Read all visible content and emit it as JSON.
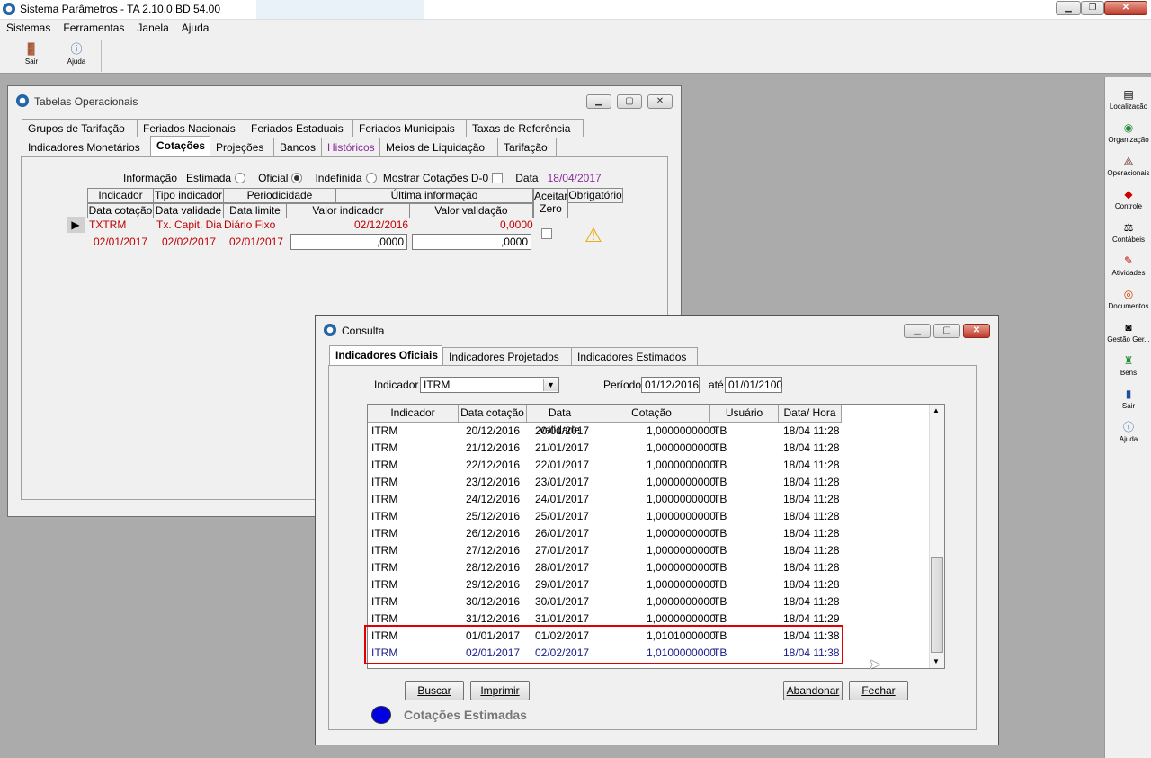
{
  "app": {
    "title": "Sistema Parâmetros -  TA 2.10.0 BD 54.00"
  },
  "menu": [
    "Sistemas",
    "Ferramentas",
    "Janela",
    "Ajuda"
  ],
  "toolbar": {
    "sair": "Sair",
    "ajuda": "Ajuda"
  },
  "dock": [
    "Localização",
    "Organização",
    "Operacionais",
    "Controle",
    "Contábeis",
    "Atividades",
    "Documentos",
    "Gestão Ger...",
    "Bens",
    "Sair",
    "Ajuda"
  ],
  "tabelas": {
    "title": "Tabelas Operacionais",
    "tabs_row1": [
      "Grupos de Tarifação",
      "Feriados Nacionais",
      "Feriados Estaduais",
      "Feriados Municipais",
      "Taxas de Referência"
    ],
    "tabs_row2": [
      "Indicadores Monetários",
      "Cotações",
      "Projeções",
      "Bancos",
      "Históricos",
      "Meios de Liquidação",
      "Tarifação"
    ],
    "info": {
      "label": "Informação",
      "estimada": "Estimada",
      "oficial": "Oficial",
      "indefinida": "Indefinida",
      "mostrar": "Mostrar Cotações D-0",
      "data_label": "Data",
      "data_value": "18/04/2017"
    },
    "header1": [
      "Indicador",
      "Tipo indicador",
      "Periodicidade",
      "Última informação"
    ],
    "header2": [
      "Data cotação",
      "Data validade",
      "Data limite",
      "Valor indicador",
      "Valor validação"
    ],
    "header_extra": {
      "aceitar": "Aceitar Zero",
      "obrigatorio": "Obrigatório"
    },
    "row1": {
      "indicador": "TXTRM",
      "tipo": "Tx. Capit. Dia Ú",
      "periodicidade": "Diário Fixo",
      "data": "02/12/2016",
      "valor": "0,0000"
    },
    "row2": {
      "data_cotacao": "02/01/2017",
      "data_validade": "02/02/2017",
      "data_limite": "02/01/2017",
      "valor_indicador": ",0000",
      "valor_validacao": ",0000"
    }
  },
  "consulta": {
    "title": "Consulta",
    "tabs": [
      "Indicadores Oficiais",
      "Indicadores Projetados",
      "Indicadores Estimados"
    ],
    "indicador_label": "Indicador",
    "indicador_value": "ITRM",
    "periodo_label": "Período",
    "periodo_from": "01/12/2016",
    "ate_label": "até",
    "periodo_to": "01/01/2100",
    "columns": [
      "Indicador",
      "Data cotação",
      "Data validade",
      "Cotação",
      "Usuário",
      "Data/ Hora"
    ],
    "rows": [
      [
        "ITRM",
        "20/12/2016",
        "20/01/2017",
        "1,0000000000",
        "TB",
        "18/04 11:28"
      ],
      [
        "ITRM",
        "21/12/2016",
        "21/01/2017",
        "1,0000000000",
        "TB",
        "18/04 11:28"
      ],
      [
        "ITRM",
        "22/12/2016",
        "22/01/2017",
        "1,0000000000",
        "TB",
        "18/04 11:28"
      ],
      [
        "ITRM",
        "23/12/2016",
        "23/01/2017",
        "1,0000000000",
        "TB",
        "18/04 11:28"
      ],
      [
        "ITRM",
        "24/12/2016",
        "24/01/2017",
        "1,0000000000",
        "TB",
        "18/04 11:28"
      ],
      [
        "ITRM",
        "25/12/2016",
        "25/01/2017",
        "1,0000000000",
        "TB",
        "18/04 11:28"
      ],
      [
        "ITRM",
        "26/12/2016",
        "26/01/2017",
        "1,0000000000",
        "TB",
        "18/04 11:28"
      ],
      [
        "ITRM",
        "27/12/2016",
        "27/01/2017",
        "1,0000000000",
        "TB",
        "18/04 11:28"
      ],
      [
        "ITRM",
        "28/12/2016",
        "28/01/2017",
        "1,0000000000",
        "TB",
        "18/04 11:28"
      ],
      [
        "ITRM",
        "29/12/2016",
        "29/01/2017",
        "1,0000000000",
        "TB",
        "18/04 11:28"
      ],
      [
        "ITRM",
        "30/12/2016",
        "30/01/2017",
        "1,0000000000",
        "TB",
        "18/04 11:28"
      ],
      [
        "ITRM",
        "31/12/2016",
        "31/01/2017",
        "1,0000000000",
        "TB",
        "18/04 11:29"
      ],
      [
        "ITRM",
        "01/01/2017",
        "01/02/2017",
        "1,0101000000",
        "TB",
        "18/04 11:38"
      ],
      [
        "ITRM",
        "02/01/2017",
        "02/02/2017",
        "1,0100000000",
        "TB",
        "18/04 11:38"
      ]
    ],
    "buttons": {
      "buscar": "Buscar",
      "imprimir": "Imprimir",
      "abandonar": "Abandonar",
      "fechar": "Fechar"
    },
    "legend": "Cotações Estimadas",
    "colors": {
      "highlight_border": "#e00000",
      "estimated": "#1a1a8c",
      "legend_dot": "#0000e0"
    }
  }
}
